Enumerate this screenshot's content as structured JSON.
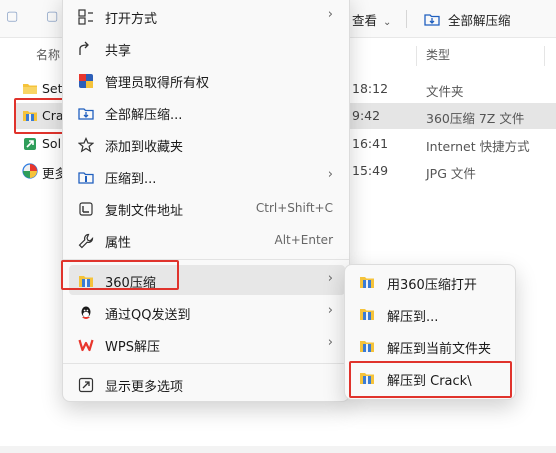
{
  "explorer": {
    "toolbar": {
      "view_label": "查看",
      "extract_all_label": "全部解压缩"
    },
    "columns": {
      "name": "名称",
      "type": "类型"
    },
    "files": [
      {
        "name": "Set",
        "time": "18:12",
        "type": "文件夹",
        "icon": "folder-icon"
      },
      {
        "name": "Cra",
        "time": "9:42",
        "type": "360压缩 7Z 文件",
        "icon": "archive-icon"
      },
      {
        "name": "Sol",
        "time": "16:41",
        "type": "Internet 快捷方式",
        "icon": "shortcut-icon"
      },
      {
        "name": "更多",
        "time": "15:49",
        "type": "JPG 文件",
        "icon": "image-icon"
      }
    ]
  },
  "context_menu": {
    "items": [
      {
        "label": "打开方式",
        "icon": "open-with-icon",
        "has_submenu": true
      },
      {
        "label": "共享",
        "icon": "share-icon"
      },
      {
        "label": "管理员取得所有权",
        "icon": "take-ownership-icon"
      },
      {
        "label": "全部解压缩...",
        "icon": "extract-all-icon"
      },
      {
        "label": "添加到收藏夹",
        "icon": "star-icon"
      },
      {
        "label": "压缩到...",
        "icon": "compress-icon",
        "has_submenu": true
      },
      {
        "label": "复制文件地址",
        "icon": "copy-path-icon",
        "shortcut": "Ctrl+Shift+C"
      },
      {
        "label": "属性",
        "icon": "wrench-icon",
        "shortcut": "Alt+Enter"
      },
      {
        "label": "360压缩",
        "icon": "360-zip-icon",
        "has_submenu": true
      },
      {
        "label": "通过QQ发送到",
        "icon": "qq-icon",
        "has_submenu": true
      },
      {
        "label": "WPS解压",
        "icon": "wps-icon",
        "has_submenu": true
      },
      {
        "label": "显示更多选项",
        "icon": "more-options-icon"
      }
    ]
  },
  "submenu_360": {
    "items": [
      {
        "label": "用360压缩打开"
      },
      {
        "label": "解压到..."
      },
      {
        "label": "解压到当前文件夹"
      },
      {
        "label": "解压到 Crack\\"
      }
    ]
  },
  "colors": {
    "highlight_border": "#e0332c",
    "menu_bg": "#f9f9f9",
    "hover_bg": "#e7e7e7",
    "folder_yellow": "#f5c33b",
    "qq_black": "#1a1a1a",
    "wps_red": "#e8362d"
  }
}
